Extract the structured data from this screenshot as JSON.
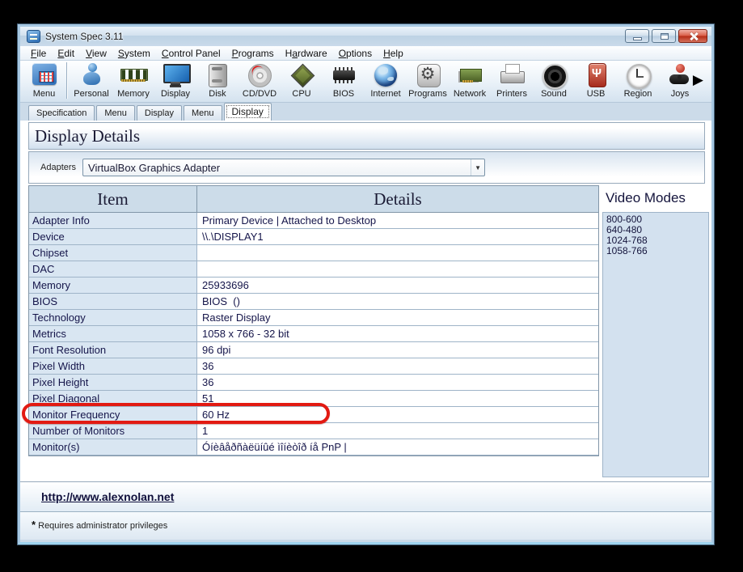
{
  "window": {
    "title": "System Spec 3.11"
  },
  "menu_bar": {
    "items": [
      {
        "label": "File",
        "u": 0
      },
      {
        "label": "Edit",
        "u": 0
      },
      {
        "label": "View",
        "u": 0
      },
      {
        "label": "System",
        "u": 0
      },
      {
        "label": "Control Panel",
        "u": 0
      },
      {
        "label": "Programs",
        "u": 0
      },
      {
        "label": "Hardware",
        "u": 1
      },
      {
        "label": "Options",
        "u": 0
      },
      {
        "label": "Help",
        "u": 0
      }
    ]
  },
  "toolbar": {
    "overflow_arrow": "▶",
    "items": [
      {
        "label": "Menu",
        "icon": "menu",
        "sep_after": true
      },
      {
        "label": "Personal",
        "icon": "personal"
      },
      {
        "label": "Memory",
        "icon": "memory"
      },
      {
        "label": "Display",
        "icon": "display"
      },
      {
        "label": "Disk",
        "icon": "disk"
      },
      {
        "label": "CD/DVD",
        "icon": "cddvd"
      },
      {
        "label": "CPU",
        "icon": "cpu"
      },
      {
        "label": "BIOS",
        "icon": "bios"
      },
      {
        "label": "Internet",
        "icon": "internet"
      },
      {
        "label": "Programs",
        "icon": "programs"
      },
      {
        "label": "Network",
        "icon": "network"
      },
      {
        "label": "Printers",
        "icon": "printers"
      },
      {
        "label": "Sound",
        "icon": "sound"
      },
      {
        "label": "USB",
        "icon": "usb"
      },
      {
        "label": "Region",
        "icon": "region"
      },
      {
        "label": "Joys",
        "icon": "joystick"
      }
    ]
  },
  "tabs": {
    "items": [
      {
        "label": "Specification"
      },
      {
        "label": "Menu"
      },
      {
        "label": "Display"
      },
      {
        "label": "Menu"
      },
      {
        "label": "Display",
        "active": true
      }
    ]
  },
  "page": {
    "title": "Display Details"
  },
  "adapters": {
    "label": "Adapters",
    "value": "VirtualBox Graphics Adapter",
    "arrow": "▼"
  },
  "table": {
    "headers": {
      "item": "Item",
      "details": "Details"
    },
    "rows": [
      {
        "item": "Adapter Info",
        "details": "Primary Device | Attached to Desktop"
      },
      {
        "item": "Device",
        "details": "\\\\.\\DISPLAY1"
      },
      {
        "item": "Chipset",
        "details": ""
      },
      {
        "item": "DAC",
        "details": ""
      },
      {
        "item": "Memory",
        "details": "25933696"
      },
      {
        "item": "BIOS",
        "details": "BIOS  ()"
      },
      {
        "item": "Technology",
        "details": "Raster Display"
      },
      {
        "item": "Metrics",
        "details": "1058 x 766 - 32 bit"
      },
      {
        "item": "Font Resolution",
        "details": "96 dpi"
      },
      {
        "item": "Pixel Width",
        "details": "36"
      },
      {
        "item": "Pixel Height",
        "details": "36"
      },
      {
        "item": "Pixel Diagonal",
        "details": "51"
      },
      {
        "item": "Monitor Frequency",
        "details": "60 Hz",
        "highlight": true
      },
      {
        "item": "Number of Monitors",
        "details": "1"
      },
      {
        "item": "Monitor(s)",
        "details": "Óíèâåðñàëüíûé ìîíèòîð íå PnP |"
      }
    ]
  },
  "video_modes": {
    "title": "Video Modes",
    "items": [
      "800-600",
      "640-480",
      "1024-768",
      "1058-766"
    ]
  },
  "footer": {
    "link": "http://www.alexnolan.net"
  },
  "status_bar": {
    "star": "*",
    "text": " Requires administrator privileges"
  },
  "colors": {
    "highlight_red": "#e21a12"
  }
}
